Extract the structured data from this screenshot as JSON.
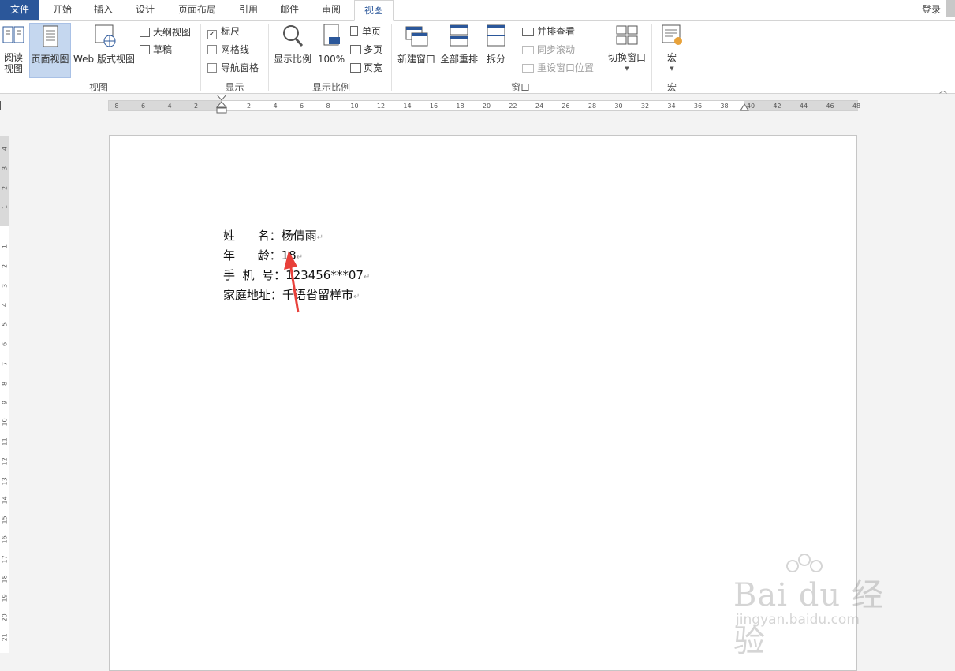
{
  "tabs": {
    "file": "文件",
    "home": "开始",
    "insert": "插入",
    "design": "设计",
    "layout": "页面布局",
    "references": "引用",
    "mailings": "邮件",
    "review": "审阅",
    "view": "视图",
    "login": "登录"
  },
  "ribbon": {
    "views": {
      "read_mode_line1": "阅读",
      "read_mode_line2": "视图",
      "print_layout": "页面视图",
      "web_layout": "Web 版式视图",
      "outline": "大纲视图",
      "draft": "草稿",
      "group_label": "视图"
    },
    "show": {
      "ruler": "标尺",
      "ruler_checked": true,
      "gridlines": "网格线",
      "nav_pane": "导航窗格",
      "group_label": "显示"
    },
    "zoom": {
      "zoom": "显示比例",
      "hundred": "100%",
      "one_page": "单页",
      "multi_page": "多页",
      "page_width": "页宽",
      "group_label": "显示比例"
    },
    "window": {
      "new_window": "新建窗口",
      "arrange_all": "全部重排",
      "split": "拆分",
      "side_by_side": "并排查看",
      "sync_scroll": "同步滚动",
      "reset_pos": "重设窗口位置",
      "switch_windows": "切换窗口",
      "group_label": "窗口"
    },
    "macros": {
      "macros": "宏",
      "group_label": "宏"
    }
  },
  "ruler": {
    "h_labels": [
      "8",
      "6",
      "4",
      "2",
      "2",
      "4",
      "6",
      "8",
      "10",
      "12",
      "14",
      "16",
      "18",
      "20",
      "22",
      "24",
      "26",
      "28",
      "30",
      "32",
      "34",
      "36",
      "38",
      "40",
      "42",
      "44",
      "46",
      "48"
    ],
    "v_labels": [
      "4",
      "3",
      "2",
      "1",
      "1",
      "2",
      "3",
      "4",
      "5",
      "6",
      "7",
      "8",
      "9",
      "10",
      "11",
      "12",
      "13",
      "14",
      "15",
      "16",
      "17",
      "18",
      "19",
      "20",
      "21"
    ]
  },
  "document": {
    "line1_label": "姓      名：",
    "line1_value": "杨倩雨",
    "line2_label": "年      龄：",
    "line2_value": "18",
    "line3_label": "手  机  号：",
    "line3_value": "123456***07",
    "line4_label": "家庭地址：",
    "line4_value": "千语省留样市",
    "para_mark": "↵"
  },
  "watermark": {
    "brand": "Bai du 经验",
    "url": "jingyan.baidu.com"
  },
  "colors": {
    "accent": "#2b579a",
    "arrow": "#e8403a"
  }
}
